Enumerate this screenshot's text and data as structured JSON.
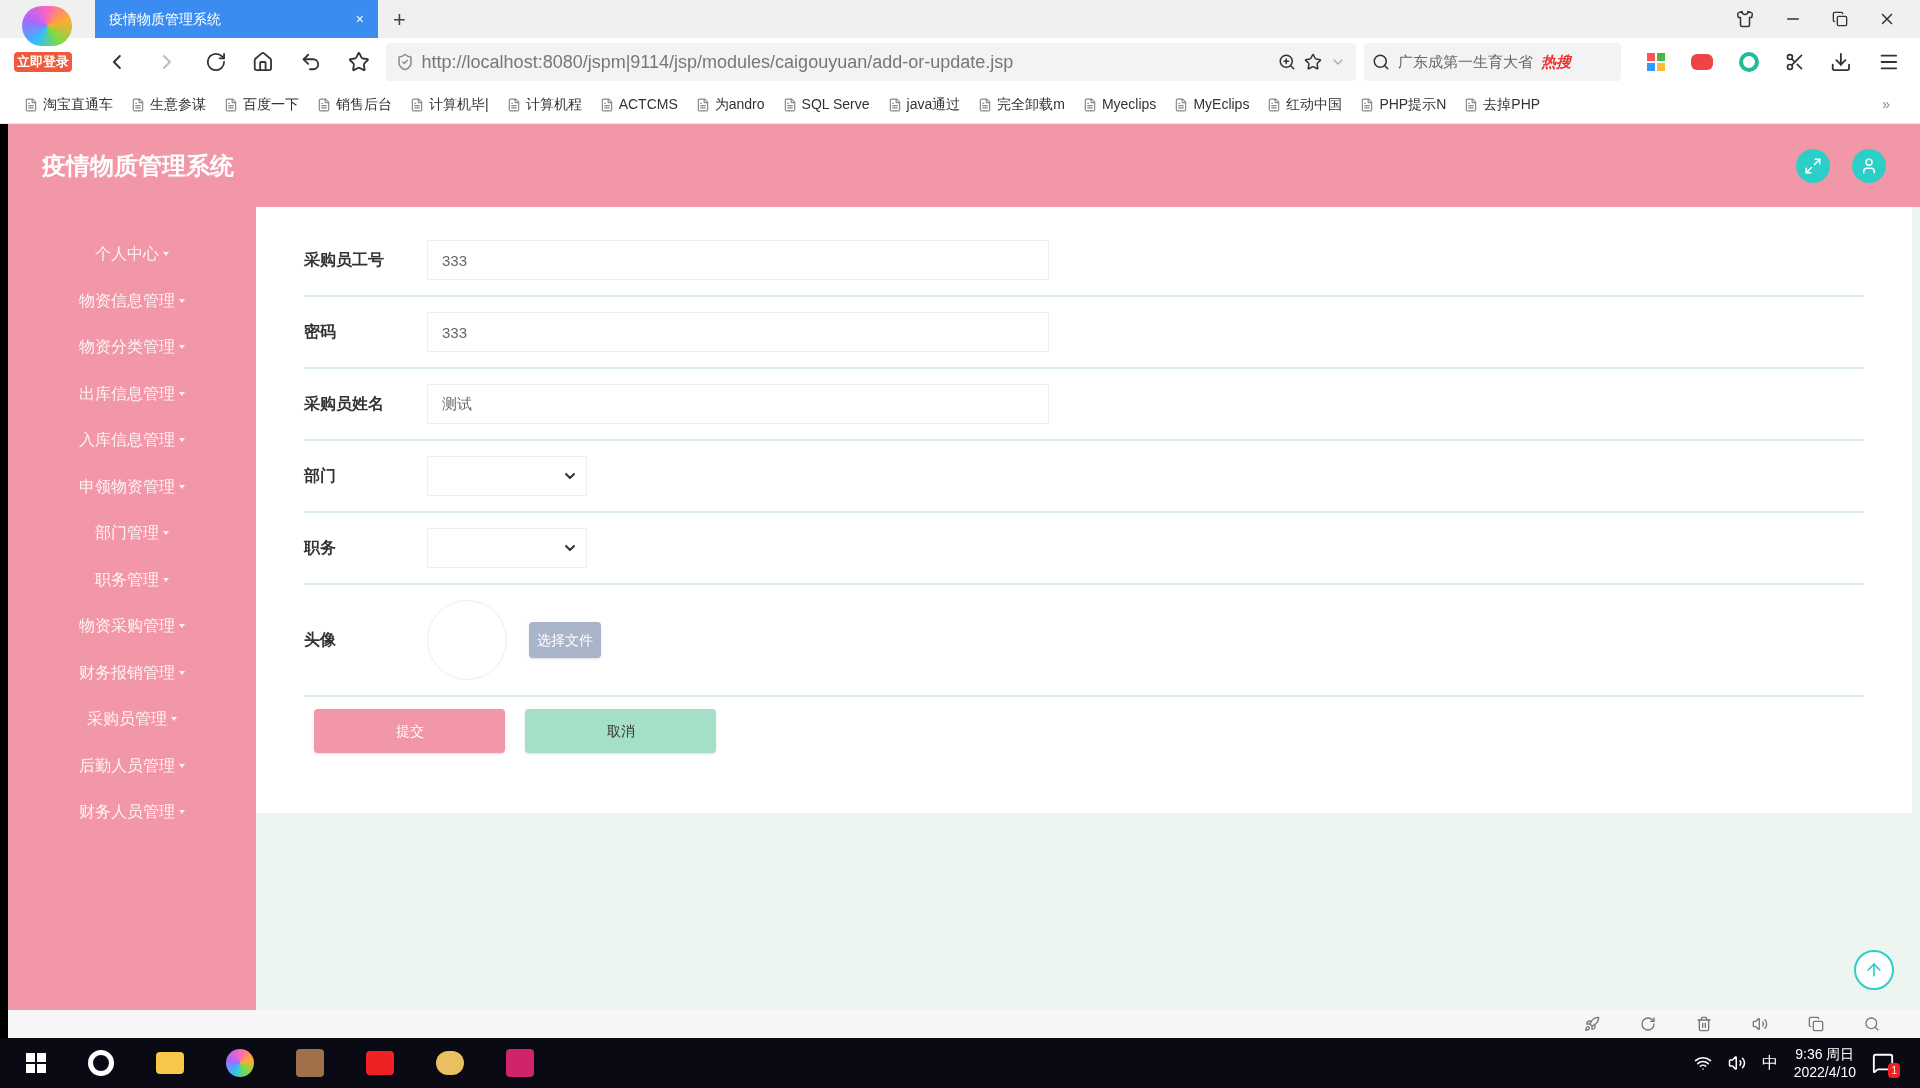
{
  "browser": {
    "badge": "立即登录",
    "tab": {
      "title": "疫情物质管理系统",
      "close": "×"
    },
    "new_tab": "+",
    "url": "http://localhost:8080/jspm|9114/jsp/modules/caigouyuan/add-or-update.jsp",
    "search": {
      "text": "广东成第一生育大省",
      "hot": "热搜"
    },
    "bookmarks": [
      "淘宝直通车",
      "生意参谋",
      "百度一下",
      "销售后台",
      "计算机毕|",
      "计算机程",
      "ACTCMS",
      "为andro",
      "SQL Serve",
      "java通过",
      "完全卸载m",
      "Myeclips",
      "MyEclips",
      "红动中国",
      "PHP提示N",
      "去掉PHP"
    ],
    "more": "»"
  },
  "app": {
    "title": "疫情物质管理系统",
    "sidebar": {
      "items": [
        "个人中心",
        "物资信息管理",
        "物资分类管理",
        "出库信息管理",
        "入库信息管理",
        "申领物资管理",
        "部门管理",
        "职务管理",
        "物资采购管理",
        "财务报销管理",
        "采购员管理",
        "后勤人员管理",
        "财务人员管理"
      ]
    },
    "form": {
      "fields": [
        {
          "kind": "input",
          "label": "采购员工号",
          "value": "333"
        },
        {
          "kind": "input",
          "label": "密码",
          "value": "333"
        },
        {
          "kind": "input",
          "label": "采购员姓名",
          "value": "测试"
        },
        {
          "kind": "select",
          "label": "部门"
        },
        {
          "kind": "select",
          "label": "职务"
        },
        {
          "kind": "image",
          "label": "头像",
          "button": "选择文件"
        }
      ],
      "buttons": [
        {
          "kind": "submit",
          "label": "提交"
        },
        {
          "kind": "cancel",
          "label": "取消"
        }
      ]
    }
  },
  "taskbar": {
    "time": "9:36 周日",
    "date": "2022/4/10",
    "ime": "中",
    "notifications": "1"
  }
}
